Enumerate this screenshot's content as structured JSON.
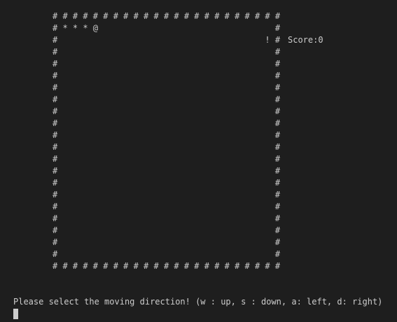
{
  "game": {
    "board_rows": [
      "# # # # # # # # # # # # # # # # # # # # # # #",
      "# * * * @                                   #",
      "#                                         ! #",
      "#                                           #",
      "#                                           #",
      "#                                           #",
      "#                                           #",
      "#                                           #",
      "#                                           #",
      "#                                           #",
      "#                                           #",
      "#                                           #",
      "#                                           #",
      "#                                           #",
      "#                                           #",
      "#                                           #",
      "#                                           #",
      "#                                           #",
      "#                                           #",
      "#                                           #",
      "#                                           #",
      "# # # # # # # # # # # # # # # # # # # # # # #"
    ],
    "score_text": "Score:0"
  },
  "terminal": {
    "prompt_text": "Please select the moving direction! (w : up, s : down, a: left, d: right)"
  }
}
